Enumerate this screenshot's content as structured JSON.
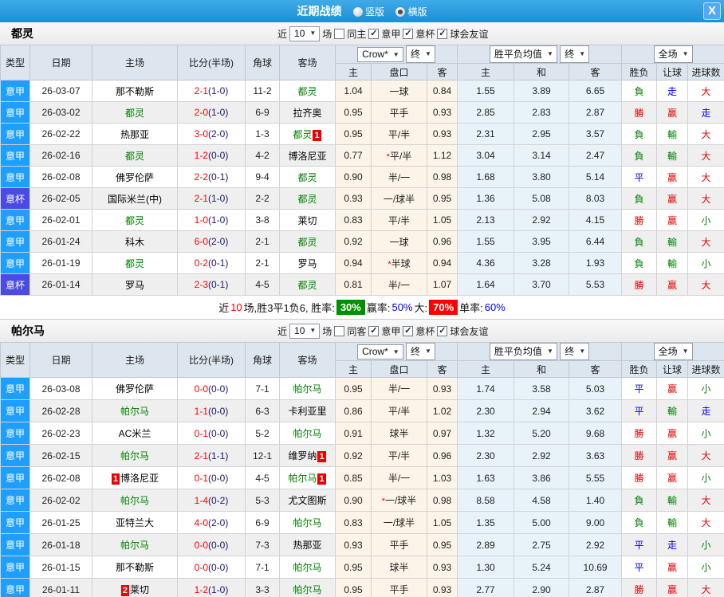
{
  "titlebar": {
    "title": "近期战绩",
    "radios": [
      {
        "label": "竖版",
        "selected": false
      },
      {
        "label": "横版",
        "selected": true
      }
    ],
    "close_label": "X"
  },
  "table_header": {
    "cols_left": [
      "类型",
      "日期",
      "主场",
      "比分(半场)",
      "角球",
      "客场"
    ],
    "sub_cols": [
      "主",
      "盘口",
      "客",
      "主",
      "和",
      "客",
      "胜负",
      "让球",
      "进球数"
    ],
    "dropdowns": {
      "odds_source": "Crow*",
      "odds_time": "终",
      "avg": "胜平负均值",
      "avg_time": "终",
      "scope": "全场"
    }
  },
  "filter_common": {
    "prefix": "近",
    "matches_value": "10",
    "suffix": "场"
  },
  "sections": [
    {
      "team": "都灵",
      "filters": [
        {
          "label": "同主",
          "checked": false
        },
        {
          "label": "意甲",
          "checked": true
        },
        {
          "label": "意杯",
          "checked": true
        },
        {
          "label": "球会友谊",
          "checked": true
        }
      ],
      "rows": [
        {
          "league": "意甲",
          "lc": "jia",
          "date": "26-03-07",
          "home": {
            "n": "那不勒斯"
          },
          "score": "2-1",
          "half": "(1-0)",
          "corner": "11-2",
          "away": {
            "n": "都灵",
            "g": 1
          },
          "odds": [
            "1.04",
            "一球",
            "0.84"
          ],
          "star": 0,
          "avg": [
            "1.55",
            "3.89",
            "6.65"
          ],
          "res": [
            [
              "負",
              "g"
            ],
            [
              "走",
              "b"
            ],
            [
              "大",
              "r"
            ]
          ]
        },
        {
          "league": "意甲",
          "lc": "jia",
          "date": "26-03-02",
          "home": {
            "n": "都灵",
            "g": 1
          },
          "score": "2-0",
          "half": "(1-0)",
          "corner": "6-9",
          "away": {
            "n": "拉齐奥"
          },
          "odds": [
            "0.95",
            "平手",
            "0.93"
          ],
          "star": 0,
          "avg": [
            "2.85",
            "2.83",
            "2.87"
          ],
          "res": [
            [
              "勝",
              "r"
            ],
            [
              "赢",
              "r"
            ],
            [
              "走",
              "b"
            ]
          ]
        },
        {
          "league": "意甲",
          "lc": "jia",
          "date": "26-02-22",
          "home": {
            "n": "热那亚"
          },
          "score": "3-0",
          "half": "(2-0)",
          "corner": "1-3",
          "away": {
            "n": "都灵",
            "g": 1,
            "b": "1",
            "bp": "post"
          },
          "odds": [
            "0.95",
            "平/半",
            "0.93"
          ],
          "star": 0,
          "avg": [
            "2.31",
            "2.95",
            "3.57"
          ],
          "res": [
            [
              "負",
              "g"
            ],
            [
              "輸",
              "g"
            ],
            [
              "大",
              "r"
            ]
          ]
        },
        {
          "league": "意甲",
          "lc": "jia",
          "date": "26-02-16",
          "home": {
            "n": "都灵",
            "g": 1
          },
          "score": "1-2",
          "half": "(0-0)",
          "corner": "4-2",
          "away": {
            "n": "博洛尼亚"
          },
          "odds": [
            "0.77",
            "平/半",
            "1.12"
          ],
          "star": 1,
          "avg": [
            "3.04",
            "3.14",
            "2.47"
          ],
          "res": [
            [
              "負",
              "g"
            ],
            [
              "輸",
              "g"
            ],
            [
              "大",
              "r"
            ]
          ]
        },
        {
          "league": "意甲",
          "lc": "jia",
          "date": "26-02-08",
          "home": {
            "n": "佛罗伦萨"
          },
          "score": "2-2",
          "half": "(0-1)",
          "corner": "9-4",
          "away": {
            "n": "都灵",
            "g": 1
          },
          "odds": [
            "0.90",
            "半/一",
            "0.98"
          ],
          "star": 0,
          "avg": [
            "1.68",
            "3.80",
            "5.14"
          ],
          "res": [
            [
              "平",
              "b"
            ],
            [
              "赢",
              "r"
            ],
            [
              "大",
              "r"
            ]
          ]
        },
        {
          "league": "意杯",
          "lc": "bei",
          "date": "26-02-05",
          "home": {
            "n": "国际米兰(中)"
          },
          "score": "2-1",
          "half": "(1-0)",
          "corner": "2-2",
          "away": {
            "n": "都灵",
            "g": 1
          },
          "odds": [
            "0.93",
            "一/球半",
            "0.95"
          ],
          "star": 0,
          "avg": [
            "1.36",
            "5.08",
            "8.03"
          ],
          "res": [
            [
              "負",
              "g"
            ],
            [
              "赢",
              "r"
            ],
            [
              "大",
              "r"
            ]
          ]
        },
        {
          "league": "意甲",
          "lc": "jia",
          "date": "26-02-01",
          "home": {
            "n": "都灵",
            "g": 1
          },
          "score": "1-0",
          "half": "(1-0)",
          "corner": "3-8",
          "away": {
            "n": "莱切"
          },
          "odds": [
            "0.83",
            "平/半",
            "1.05"
          ],
          "star": 0,
          "avg": [
            "2.13",
            "2.92",
            "4.15"
          ],
          "res": [
            [
              "勝",
              "r"
            ],
            [
              "赢",
              "r"
            ],
            [
              "小",
              "g"
            ]
          ]
        },
        {
          "league": "意甲",
          "lc": "jia",
          "date": "26-01-24",
          "home": {
            "n": "科木"
          },
          "score": "6-0",
          "half": "(2-0)",
          "corner": "2-1",
          "away": {
            "n": "都灵",
            "g": 1
          },
          "odds": [
            "0.92",
            "一球",
            "0.96"
          ],
          "star": 0,
          "avg": [
            "1.55",
            "3.95",
            "6.44"
          ],
          "res": [
            [
              "負",
              "g"
            ],
            [
              "輸",
              "g"
            ],
            [
              "大",
              "r"
            ]
          ]
        },
        {
          "league": "意甲",
          "lc": "jia",
          "date": "26-01-19",
          "home": {
            "n": "都灵",
            "g": 1
          },
          "score": "0-2",
          "half": "(0-1)",
          "corner": "2-1",
          "away": {
            "n": "罗马"
          },
          "odds": [
            "0.94",
            "半球",
            "0.94"
          ],
          "star": 1,
          "avg": [
            "4.36",
            "3.28",
            "1.93"
          ],
          "res": [
            [
              "負",
              "g"
            ],
            [
              "輸",
              "g"
            ],
            [
              "小",
              "g"
            ]
          ]
        },
        {
          "league": "意杯",
          "lc": "bei",
          "date": "26-01-14",
          "home": {
            "n": "罗马"
          },
          "score": "2-3",
          "half": "(0-1)",
          "corner": "4-5",
          "away": {
            "n": "都灵",
            "g": 1
          },
          "odds": [
            "0.81",
            "半/一",
            "1.07"
          ],
          "star": 0,
          "avg": [
            "1.64",
            "3.70",
            "5.53"
          ],
          "res": [
            [
              "勝",
              "r"
            ],
            [
              "赢",
              "r"
            ],
            [
              "大",
              "r"
            ]
          ]
        }
      ],
      "summary_parts": [
        {
          "text": "近",
          "style": "plain"
        },
        {
          "text": "10",
          "style": "red"
        },
        {
          "text": "场,胜3平1负6, 胜率:",
          "style": "plain"
        },
        {
          "text": "30%",
          "style": "bg-green"
        },
        {
          "text": "赢率:",
          "style": "plain"
        },
        {
          "text": "50%",
          "style": "blue"
        },
        {
          "text": "大:",
          "style": "plain"
        },
        {
          "text": "70%",
          "style": "bg-red"
        },
        {
          "text": "单率:",
          "style": "plain"
        },
        {
          "text": "60%",
          "style": "blue"
        }
      ]
    },
    {
      "team": "帕尔马",
      "filters": [
        {
          "label": "同客",
          "checked": false
        },
        {
          "label": "意甲",
          "checked": true
        },
        {
          "label": "意杯",
          "checked": true
        },
        {
          "label": "球会友谊",
          "checked": true
        }
      ],
      "rows": [
        {
          "league": "意甲",
          "lc": "jia",
          "date": "26-03-08",
          "home": {
            "n": "佛罗伦萨"
          },
          "score": "0-0",
          "half": "(0-0)",
          "corner": "7-1",
          "away": {
            "n": "帕尔马",
            "g": 1
          },
          "odds": [
            "0.95",
            "半/一",
            "0.93"
          ],
          "star": 0,
          "avg": [
            "1.74",
            "3.58",
            "5.03"
          ],
          "res": [
            [
              "平",
              "b"
            ],
            [
              "赢",
              "r"
            ],
            [
              "小",
              "g"
            ]
          ]
        },
        {
          "league": "意甲",
          "lc": "jia",
          "date": "26-02-28",
          "home": {
            "n": "帕尔马",
            "g": 1
          },
          "score": "1-1",
          "half": "(0-0)",
          "corner": "6-3",
          "away": {
            "n": "卡利亚里"
          },
          "odds": [
            "0.86",
            "平/半",
            "1.02"
          ],
          "star": 0,
          "avg": [
            "2.30",
            "2.94",
            "3.62"
          ],
          "res": [
            [
              "平",
              "b"
            ],
            [
              "輸",
              "g"
            ],
            [
              "走",
              "b"
            ]
          ]
        },
        {
          "league": "意甲",
          "lc": "jia",
          "date": "26-02-23",
          "home": {
            "n": "AC米兰"
          },
          "score": "0-1",
          "half": "(0-0)",
          "corner": "5-2",
          "away": {
            "n": "帕尔马",
            "g": 1
          },
          "odds": [
            "0.91",
            "球半",
            "0.97"
          ],
          "star": 0,
          "avg": [
            "1.32",
            "5.20",
            "9.68"
          ],
          "res": [
            [
              "勝",
              "r"
            ],
            [
              "赢",
              "r"
            ],
            [
              "小",
              "g"
            ]
          ]
        },
        {
          "league": "意甲",
          "lc": "jia",
          "date": "26-02-15",
          "home": {
            "n": "帕尔马",
            "g": 1
          },
          "score": "2-1",
          "half": "(1-1)",
          "corner": "12-1",
          "away": {
            "n": "维罗纳",
            "b": "1",
            "bp": "post"
          },
          "odds": [
            "0.92",
            "平/半",
            "0.96"
          ],
          "star": 0,
          "avg": [
            "2.30",
            "2.92",
            "3.63"
          ],
          "res": [
            [
              "勝",
              "r"
            ],
            [
              "赢",
              "r"
            ],
            [
              "大",
              "r"
            ]
          ]
        },
        {
          "league": "意甲",
          "lc": "jia",
          "date": "26-02-08",
          "home": {
            "n": "博洛尼亚",
            "b": "1",
            "bp": "pre"
          },
          "score": "0-1",
          "half": "(0-0)",
          "corner": "4-5",
          "away": {
            "n": "帕尔马",
            "g": 1,
            "b": "1",
            "bp": "post"
          },
          "odds": [
            "0.85",
            "半/一",
            "1.03"
          ],
          "star": 0,
          "avg": [
            "1.63",
            "3.86",
            "5.55"
          ],
          "res": [
            [
              "勝",
              "r"
            ],
            [
              "赢",
              "r"
            ],
            [
              "小",
              "g"
            ]
          ]
        },
        {
          "league": "意甲",
          "lc": "jia",
          "date": "26-02-02",
          "home": {
            "n": "帕尔马",
            "g": 1
          },
          "score": "1-4",
          "half": "(0-2)",
          "corner": "5-3",
          "away": {
            "n": "尤文图斯"
          },
          "odds": [
            "0.90",
            "一/球半",
            "0.98"
          ],
          "star": 1,
          "avg": [
            "8.58",
            "4.58",
            "1.40"
          ],
          "res": [
            [
              "負",
              "g"
            ],
            [
              "輸",
              "g"
            ],
            [
              "大",
              "r"
            ]
          ]
        },
        {
          "league": "意甲",
          "lc": "jia",
          "date": "26-01-25",
          "home": {
            "n": "亚特兰大"
          },
          "score": "4-0",
          "half": "(2-0)",
          "corner": "6-9",
          "away": {
            "n": "帕尔马",
            "g": 1
          },
          "odds": [
            "0.83",
            "一/球半",
            "1.05"
          ],
          "star": 0,
          "avg": [
            "1.35",
            "5.00",
            "9.00"
          ],
          "res": [
            [
              "負",
              "g"
            ],
            [
              "輸",
              "g"
            ],
            [
              "大",
              "r"
            ]
          ]
        },
        {
          "league": "意甲",
          "lc": "jia",
          "date": "26-01-18",
          "home": {
            "n": "帕尔马",
            "g": 1
          },
          "score": "0-0",
          "half": "(0-0)",
          "corner": "7-3",
          "away": {
            "n": "热那亚"
          },
          "odds": [
            "0.93",
            "平手",
            "0.95"
          ],
          "star": 0,
          "avg": [
            "2.89",
            "2.75",
            "2.92"
          ],
          "res": [
            [
              "平",
              "b"
            ],
            [
              "走",
              "b"
            ],
            [
              "小",
              "g"
            ]
          ]
        },
        {
          "league": "意甲",
          "lc": "jia",
          "date": "26-01-15",
          "home": {
            "n": "那不勒斯"
          },
          "score": "0-0",
          "half": "(0-0)",
          "corner": "7-1",
          "away": {
            "n": "帕尔马",
            "g": 1
          },
          "odds": [
            "0.95",
            "球半",
            "0.93"
          ],
          "star": 0,
          "avg": [
            "1.30",
            "5.24",
            "10.69"
          ],
          "res": [
            [
              "平",
              "b"
            ],
            [
              "赢",
              "r"
            ],
            [
              "小",
              "g"
            ]
          ]
        },
        {
          "league": "意甲",
          "lc": "jia",
          "date": "26-01-11",
          "home": {
            "n": "莱切",
            "b": "2",
            "bp": "pre"
          },
          "score": "1-2",
          "half": "(1-0)",
          "corner": "3-3",
          "away": {
            "n": "帕尔马",
            "g": 1
          },
          "odds": [
            "0.95",
            "平手",
            "0.93"
          ],
          "star": 0,
          "avg": [
            "2.77",
            "2.90",
            "2.87"
          ],
          "res": [
            [
              "勝",
              "r"
            ],
            [
              "赢",
              "r"
            ],
            [
              "大",
              "r"
            ]
          ]
        }
      ]
    }
  ]
}
